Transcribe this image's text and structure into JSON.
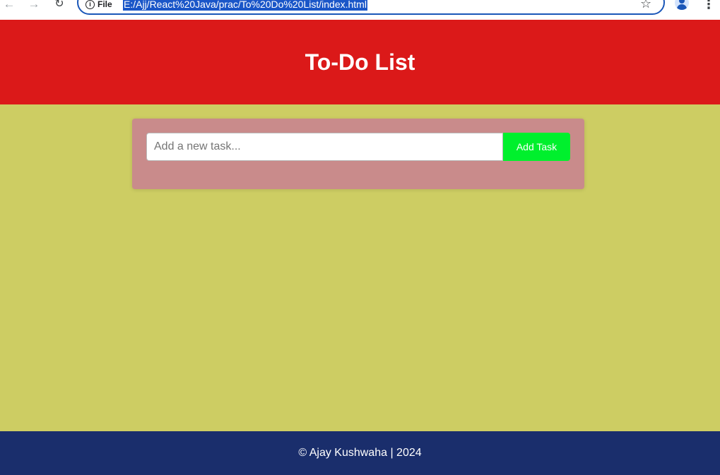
{
  "browser": {
    "nav_back_icon": "arrow-left-icon",
    "nav_forward_icon": "arrow-right-icon",
    "reload_icon": "reload-icon",
    "site_info_label": "File",
    "url": "E:/Ajj/React%20Java/prac/To%20Do%20List/index.html",
    "bookmark_icon": "star-icon",
    "profile_icon": "profile-icon",
    "menu_icon": "kebab-menu-icon"
  },
  "header": {
    "title": "To-Do List",
    "background_color": "#db1919"
  },
  "task_form": {
    "input_value": "",
    "input_placeholder": "Add a new task...",
    "add_button_label": "Add Task",
    "card_color": "#c98b8b",
    "button_color": "#00f02d"
  },
  "tasks": [],
  "footer": {
    "text": "© Ajay Kushwaha | 2024",
    "background_color": "#1a2e6c"
  },
  "page": {
    "background_color": "#cdcd63"
  }
}
